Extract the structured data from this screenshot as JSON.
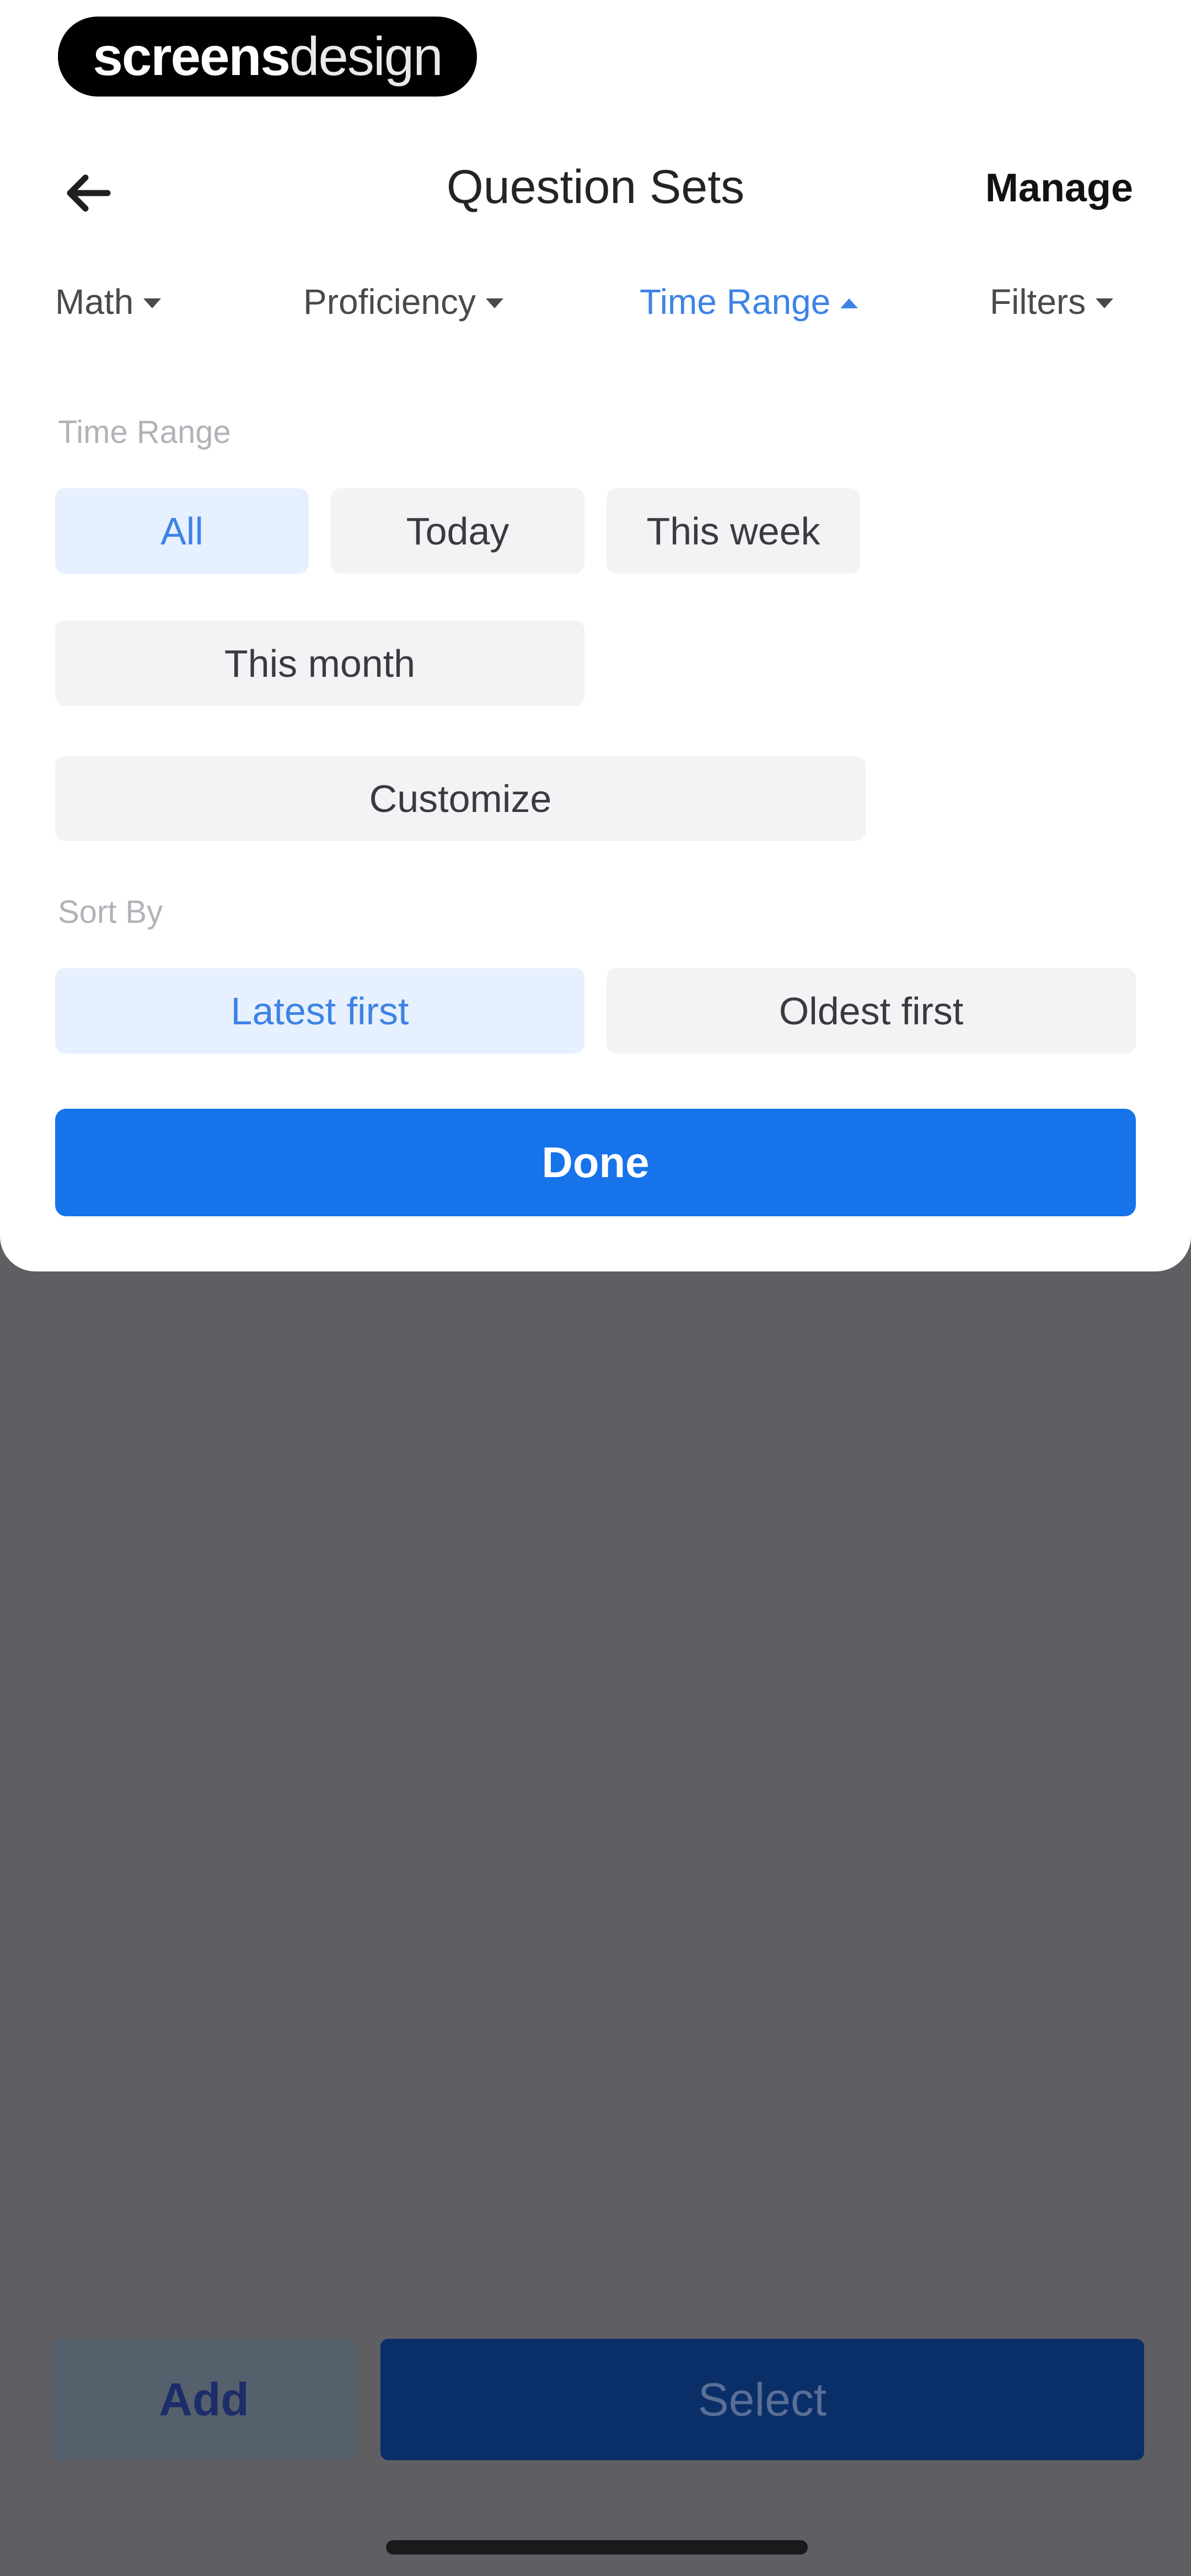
{
  "brand": {
    "part1": "screens",
    "part2": "design"
  },
  "header": {
    "title": "Question Sets",
    "manage_label": "Manage",
    "back_icon": "arrow-left-icon"
  },
  "filters": [
    {
      "label": "Math",
      "active": false
    },
    {
      "label": "Proficiency",
      "active": false
    },
    {
      "label": "Time Range",
      "active": true
    },
    {
      "label": "Filters",
      "active": false
    }
  ],
  "time_range": {
    "label": "Time Range",
    "options": [
      "All",
      "Today",
      "This week",
      "This month",
      "Customize"
    ],
    "selected": "All"
  },
  "sort_by": {
    "label": "Sort By",
    "options": [
      "Latest first",
      "Oldest first"
    ],
    "selected": "Latest first"
  },
  "done_label": "Done",
  "bottom_bar": {
    "add_label": "Add",
    "select_label": "Select"
  },
  "colors": {
    "accent": "#1673ea",
    "accent_text": "#3d83e6",
    "selected_bg": "#e7f0fe",
    "chip_bg": "#f2f3f5",
    "overlay": "#5f5f63"
  }
}
